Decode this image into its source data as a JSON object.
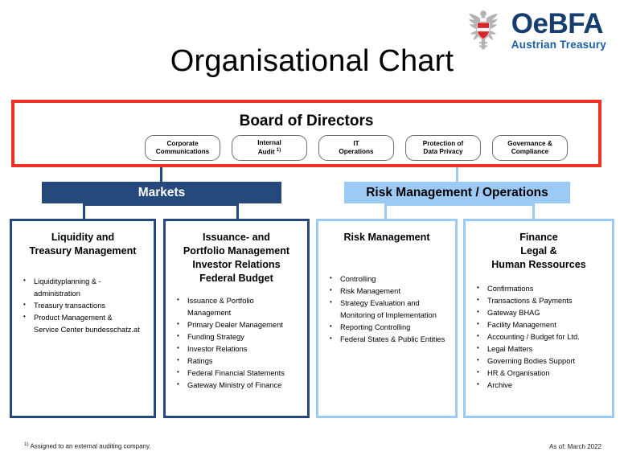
{
  "logo": {
    "emblem": "austrian-eagle-icon",
    "main": "OeBFA",
    "sub": "Austrian Treasury"
  },
  "title": "Organisational Chart",
  "board": {
    "title": "Board of Directors",
    "units": [
      {
        "line1": "Corporate",
        "line2": "Communications",
        "footnote": ""
      },
      {
        "line1": "Internal",
        "line2": "Audit",
        "footnote": "1)"
      },
      {
        "line1": "IT",
        "line2": "Operations",
        "footnote": ""
      },
      {
        "line1": "Protection of",
        "line2": "Data Privacy",
        "footnote": ""
      },
      {
        "line1": "Governance &",
        "line2": "Compliance",
        "footnote": ""
      }
    ]
  },
  "divisions": [
    {
      "label": "Markets",
      "style": "navy"
    },
    {
      "label": "Risk Management / Operations",
      "style": "light"
    }
  ],
  "departments": [
    {
      "title": "Liquidity and\nTreasury Management",
      "style": "navy",
      "items": [
        "Liquidityplanning & -administration",
        "Treasury transactions",
        "Product Management &\n   Service Center bundesschatz.at"
      ]
    },
    {
      "title": "Issuance- and\nPortfolio Management\nInvestor Relations\nFederal Budget",
      "style": "navy",
      "items": [
        "Issuance & Portfolio Management",
        "Primary Dealer Management",
        "Funding Strategy",
        "Investor Relations",
        "Ratings",
        "Federal Financial Statements",
        "Gateway Ministry of Finance"
      ]
    },
    {
      "title": "Risk Management",
      "style": "light",
      "items": [
        "Controlling",
        "Risk Management",
        "Strategy Evaluation and\n   Monitoring of Implementation",
        "Reporting Controlling",
        "Federal States & Public Entities"
      ]
    },
    {
      "title": "Finance\nLegal &\nHuman Ressources",
      "style": "light",
      "items": [
        "Confirmations",
        "Transactions & Payments",
        "Gateway BHAG",
        "Facility Management",
        "Accounting / Budget for Ltd.",
        "Legal Matters",
        "Governing Bodies Support",
        "HR & Organisation",
        "Archive"
      ]
    }
  ],
  "footer": {
    "footnote_marker": "1)",
    "footnote_text": " Assigned to an external auditing company.",
    "as_of": "As of: March 2022"
  },
  "colors": {
    "navy": "#26497C",
    "light_blue": "#9DC9F5",
    "red": "#ED3124",
    "logo_blue": "#153D6F"
  }
}
